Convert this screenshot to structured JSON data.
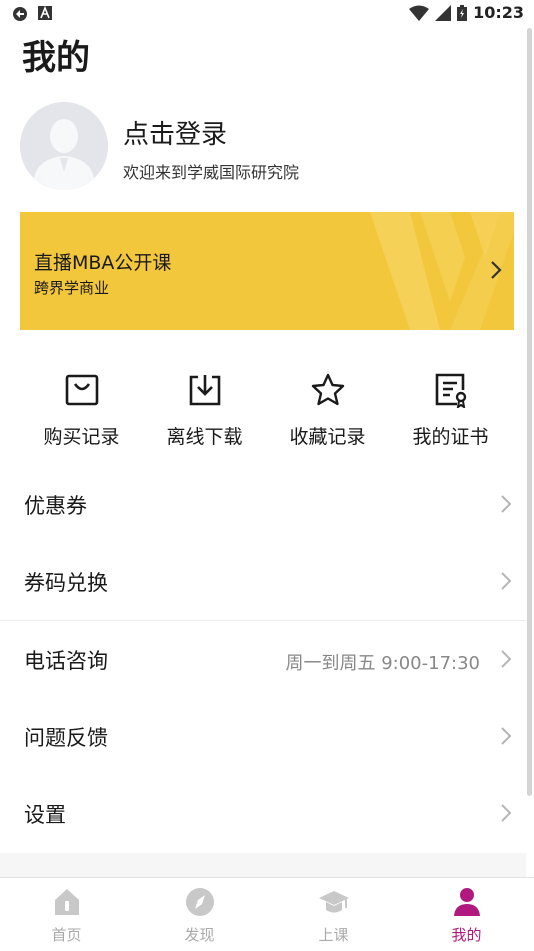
{
  "status_bar": {
    "time": "10:23"
  },
  "page": {
    "title": "我的"
  },
  "profile": {
    "login_label": "点击登录",
    "welcome": "欢迎来到学威国际研究院"
  },
  "banner": {
    "title": "直播MBA公开课",
    "subtitle": "跨界学商业"
  },
  "quick_actions": [
    {
      "label": "购买记录",
      "icon": "shopping-bag-icon"
    },
    {
      "label": "离线下载",
      "icon": "download-icon"
    },
    {
      "label": "收藏记录",
      "icon": "star-icon"
    },
    {
      "label": "我的证书",
      "icon": "certificate-icon"
    }
  ],
  "menu": [
    {
      "label": "优惠券",
      "value": ""
    },
    {
      "label": "券码兑换",
      "value": ""
    },
    {
      "label": "电话咨询",
      "value": "周一到周五 9:00-17:30"
    },
    {
      "label": "问题反馈",
      "value": ""
    },
    {
      "label": "设置",
      "value": ""
    }
  ],
  "tabbar": {
    "tabs": [
      {
        "label": "首页",
        "icon": "home-icon"
      },
      {
        "label": "发现",
        "icon": "compass-icon"
      },
      {
        "label": "上课",
        "icon": "graduation-cap-icon"
      },
      {
        "label": "我的",
        "icon": "person-icon"
      }
    ],
    "active_index": 3
  },
  "colors": {
    "banner": "#f3c73c",
    "accent": "#b0197e",
    "text": "#1a1a1a",
    "muted": "#888888",
    "tab_inactive": "#aaaaaa"
  }
}
